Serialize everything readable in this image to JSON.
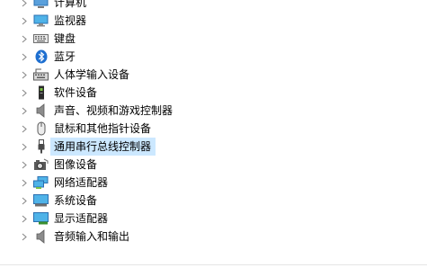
{
  "tree": {
    "items": [
      {
        "label": "计算机",
        "icon": "computer-icon"
      },
      {
        "label": "监视器",
        "icon": "monitor-icon"
      },
      {
        "label": "键盘",
        "icon": "keyboard-icon"
      },
      {
        "label": "蓝牙",
        "icon": "bluetooth-icon"
      },
      {
        "label": "人体学输入设备",
        "icon": "hid-icon"
      },
      {
        "label": "软件设备",
        "icon": "software-device-icon"
      },
      {
        "label": "声音、视频和游戏控制器",
        "icon": "speaker-icon"
      },
      {
        "label": "鼠标和其他指针设备",
        "icon": "mouse-icon"
      },
      {
        "label": "通用串行总线控制器",
        "icon": "usb-icon",
        "selected": true
      },
      {
        "label": "图像设备",
        "icon": "camera-icon"
      },
      {
        "label": "网络适配器",
        "icon": "network-adapter-icon"
      },
      {
        "label": "系统设备",
        "icon": "system-device-icon"
      },
      {
        "label": "显示适配器",
        "icon": "display-adapter-icon"
      },
      {
        "label": "音频输入和输出",
        "icon": "audio-io-icon"
      }
    ]
  },
  "colors": {
    "selection": "#cce8ff",
    "chevron": "#8a8a8a",
    "icon_blue": "#1e88e5",
    "icon_gray": "#6e6e6e"
  }
}
